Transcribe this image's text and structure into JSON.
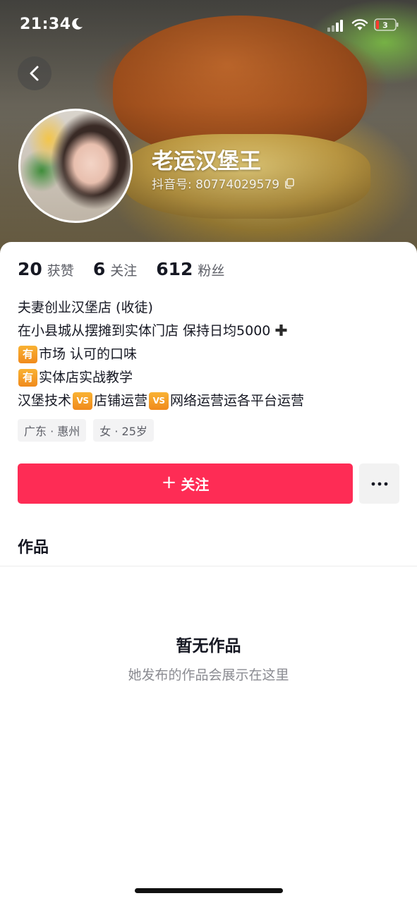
{
  "status_bar": {
    "time": "21:34",
    "icons": [
      "moon-icon",
      "signal-icon",
      "wifi-icon",
      "battery-icon"
    ],
    "battery_text": "3"
  },
  "nav": {
    "back_icon": "chevron-left-icon"
  },
  "profile": {
    "name": "老运汉堡王",
    "id_label": "抖音号: 80774029579",
    "stats": [
      {
        "value": "20",
        "label": "获赞"
      },
      {
        "value": "6",
        "label": "关注"
      },
      {
        "value": "612",
        "label": "粉丝"
      }
    ],
    "bio": {
      "line1": "夫妻创业汉堡店 (收徒)",
      "line2": "在小县城从摆摊到实体门店 保持日均5000",
      "line3_badge": "有",
      "line3": "市场 认可的口味",
      "line4_badge": "有",
      "line4": "实体店实战教学",
      "line5_a": "汉堡技术",
      "line5_vs1": "VS",
      "line5_b": "店铺运营",
      "line5_vs2": "VS",
      "line5_c": "网络运营运各平台运营"
    },
    "tags": [
      "广东 · 惠州",
      "女 · 25岁"
    ]
  },
  "actions": {
    "follow_label": "关注",
    "follow_plus": "+",
    "more_icon": "more-dots-icon"
  },
  "works": {
    "title": "作品",
    "empty_title": "暂无作品",
    "empty_subtitle": "她发布的作品会展示在这里"
  },
  "colors": {
    "accent": "#fe2c55",
    "badge": "#f5a028",
    "text_primary": "#161823",
    "text_secondary": "#8a8b91"
  }
}
